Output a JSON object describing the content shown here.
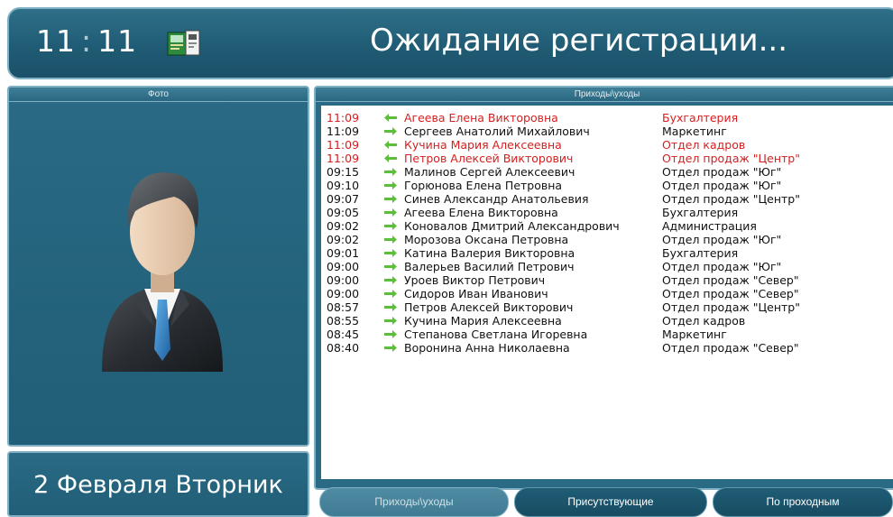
{
  "header": {
    "hour": "11",
    "separator": ":",
    "minute": "11",
    "app_icon": "id-card-reader-icon",
    "status": "Ожидание регистрации..."
  },
  "photo_panel": {
    "title": "Фото",
    "avatar_icon": "businessman-avatar-icon"
  },
  "date_panel": {
    "text": "2 Февраля Вторник"
  },
  "log_panel": {
    "title": "Приходы\\уходы",
    "rows": [
      {
        "time": "11:09",
        "direction": "out",
        "name": "Агеева Елена Викторовна",
        "dept": "Бухгалтерия",
        "highlight": true
      },
      {
        "time": "11:09",
        "direction": "in",
        "name": "Сергеев Анатолий Михайлович",
        "dept": "Маркетинг",
        "highlight": false
      },
      {
        "time": "11:09",
        "direction": "out",
        "name": "Кучина Мария Алексеевна",
        "dept": "Отдел кадров",
        "highlight": true
      },
      {
        "time": "11:09",
        "direction": "out",
        "name": "Петров Алексей Викторович",
        "dept": "Отдел продаж \"Центр\"",
        "highlight": true
      },
      {
        "time": "09:15",
        "direction": "in",
        "name": "Малинов Сергей Алексеевич",
        "dept": "Отдел продаж \"Юг\"",
        "highlight": false
      },
      {
        "time": "09:10",
        "direction": "in",
        "name": "Горюнова Елена Петровна",
        "dept": "Отдел продаж \"Юг\"",
        "highlight": false
      },
      {
        "time": "09:07",
        "direction": "in",
        "name": "Синев Александр Анатольевия",
        "dept": "Отдел продаж \"Центр\"",
        "highlight": false
      },
      {
        "time": "09:05",
        "direction": "in",
        "name": "Агеева Елена Викторовна",
        "dept": "Бухгалтерия",
        "highlight": false
      },
      {
        "time": "09:02",
        "direction": "in",
        "name": "Коновалов Дмитрий Александрович",
        "dept": "Администрация",
        "highlight": false
      },
      {
        "time": "09:02",
        "direction": "in",
        "name": "Морозова Оксана Петровна",
        "dept": "Отдел продаж \"Юг\"",
        "highlight": false
      },
      {
        "time": "09:01",
        "direction": "in",
        "name": "Катина Валерия Викторовна",
        "dept": "Бухгалтерия",
        "highlight": false
      },
      {
        "time": "09:00",
        "direction": "in",
        "name": "Валерьев Василий Петрович",
        "dept": "Отдел продаж \"Юг\"",
        "highlight": false
      },
      {
        "time": "09:00",
        "direction": "in",
        "name": "Уроев Виктор Петрович",
        "dept": "Отдел продаж \"Север\"",
        "highlight": false
      },
      {
        "time": "09:00",
        "direction": "in",
        "name": "Сидоров Иван Иванович",
        "dept": "Отдел продаж \"Север\"",
        "highlight": false
      },
      {
        "time": "08:57",
        "direction": "in",
        "name": "Петров Алексей Викторович",
        "dept": "Отдел продаж \"Центр\"",
        "highlight": false
      },
      {
        "time": "08:55",
        "direction": "in",
        "name": "Кучина Мария Алексеевна",
        "dept": "Отдел кадров",
        "highlight": false
      },
      {
        "time": "08:45",
        "direction": "in",
        "name": "Степанова Светлана Игоревна",
        "dept": "Маркетинг",
        "highlight": false
      },
      {
        "time": "08:40",
        "direction": "in",
        "name": "Воронина Анна Николаевна",
        "dept": "Отдел продаж \"Север\"",
        "highlight": false
      }
    ]
  },
  "tabs": [
    {
      "label": "Приходы\\уходы",
      "active": false
    },
    {
      "label": "Присутствующие",
      "active": true
    },
    {
      "label": "По проходным",
      "active": true
    }
  ],
  "colors": {
    "highlight_text": "#d62020",
    "arrow": "#5cbf3a",
    "panel": "#215e77"
  }
}
